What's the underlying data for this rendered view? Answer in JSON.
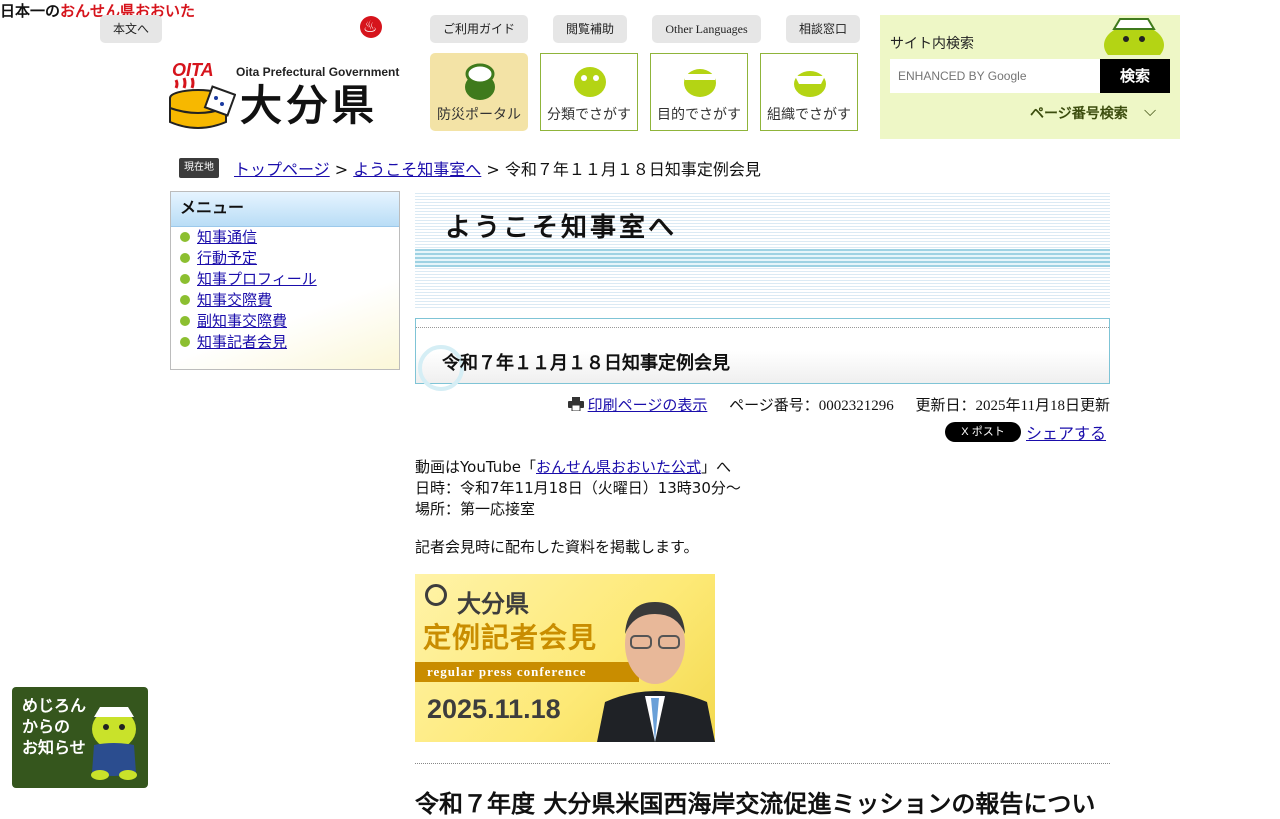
{
  "header": {
    "skip_link": "本文へ",
    "tagline_prefix": "日本一の",
    "tagline_highlight": "おんせん県おおいた",
    "top_links": [
      "ご利用ガイド",
      "閲覧補助",
      "Other Languages",
      "相談窓口"
    ],
    "logo_en": "Oita Prefectural Government",
    "logo_jp": "大分県",
    "logo_mark_text": "OITA",
    "nav_tiles": [
      "防災ポータル",
      "分類でさがす",
      "目的でさがす",
      "組織でさがす"
    ]
  },
  "search": {
    "title": "サイト内検索",
    "placeholder": "ENHANCED BY Google",
    "button": "検索",
    "page_number_search": "ページ番号検索"
  },
  "breadcrumb": {
    "badge": "現在地",
    "items": [
      "トップページ",
      "ようこそ知事室へ",
      "令和７年１１月１８日知事定例会見"
    ],
    "separator": ">"
  },
  "menu": {
    "heading": "メニュー",
    "items": [
      "知事通信",
      "行動予定",
      "知事プロフィール",
      "知事交際費",
      "副知事交際費",
      "知事記者会見"
    ]
  },
  "banner": {
    "title": "ようこそ知事室へ"
  },
  "page": {
    "title": "令和７年１１月１８日知事定例会見",
    "print_link": "印刷ページの表示",
    "page_number": "ページ番号：0002321296",
    "updated": "更新日：2025年11月18日更新",
    "x_post": "X ポスト",
    "share": "シェアする",
    "video_prefix": "動画はYouTube「",
    "video_link": "おんせん県おおいた公式",
    "video_suffix": "」へ",
    "datetime": "日時：令和7年11月18日（火曜日）13時30分～",
    "place": "場所：第一応接室",
    "note": "記者会見時に配布した資料を掲載します。",
    "thumbnail": {
      "org": "大分県",
      "title": "定例記者会見",
      "subtitle": "regular press conference",
      "date": "2025.11.18"
    },
    "section_heading": "令和７年度 大分県米国西海岸交流促進ミッションの報告につい"
  },
  "mejiro_banner": {
    "text": "めじろん\nからの\nお知らせ"
  },
  "colors": {
    "accent_green": "#8fb43a",
    "search_bg": "#eef7c6",
    "mejiro_bg": "#35561d",
    "link": "#1a0dab"
  }
}
